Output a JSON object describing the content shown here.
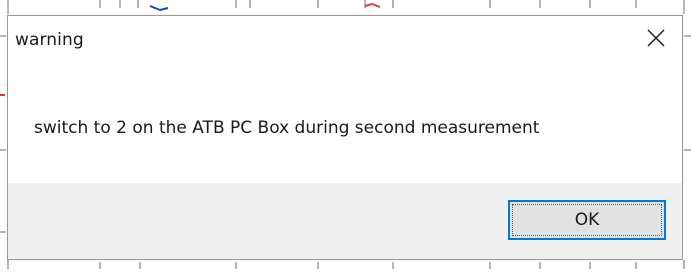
{
  "dialog": {
    "title": "warning",
    "message": "switch to 2 on the ATB PC Box during second measurement",
    "ok_label": "OK",
    "close_icon": "close-icon"
  },
  "colors": {
    "dialog_background": "#ffffff",
    "footer_background": "#f0f0f0",
    "button_face": "#e1e1e1",
    "button_focus_border": "#0078d7",
    "background_plot_blue": "#1f3fbf",
    "background_plot_red": "#d23c3c"
  }
}
